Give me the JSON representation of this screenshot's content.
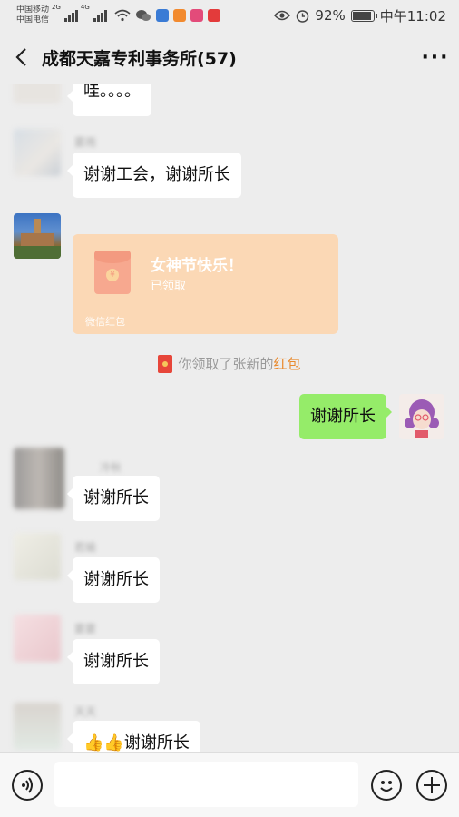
{
  "status_bar": {
    "carrier_1": "中国移动",
    "carrier_2": "中国电信",
    "net_1": "2G",
    "net_2": "4G",
    "battery": "92%",
    "time": "中午11:02"
  },
  "header": {
    "title": "成都天嘉专利事务所(57)",
    "back_icon": "chevron-left-icon",
    "more_label": "···"
  },
  "messages": {
    "m1": {
      "text": "哇。。。。"
    },
    "m2": {
      "sender": "雾雨",
      "text": "谢谢工会，谢谢所长"
    },
    "red_packet": {
      "title": "女神节快乐！",
      "status": "已领取",
      "label": "微信红包"
    },
    "system": {
      "prefix": "你领取了张新的",
      "highlight": "红包"
    },
    "m3": {
      "text": "谢谢所长"
    },
    "m4": {
      "sender": "冷秋",
      "text": "谢谢所长"
    },
    "m5": {
      "sender": "若瑜",
      "text": "谢谢所长"
    },
    "m6": {
      "sender": "雾雾",
      "text": "谢谢所长"
    },
    "m7": {
      "sender": "天天",
      "text": "👍👍谢谢所长"
    }
  },
  "input_bar": {
    "voice_icon": "voice-icon",
    "emoji_icon": "emoji-icon",
    "plus_icon": "plus-icon"
  },
  "colors": {
    "my_bubble": "#95ec69",
    "red_packet_bg": "#fbd8b5",
    "highlight": "#e98a2e"
  }
}
